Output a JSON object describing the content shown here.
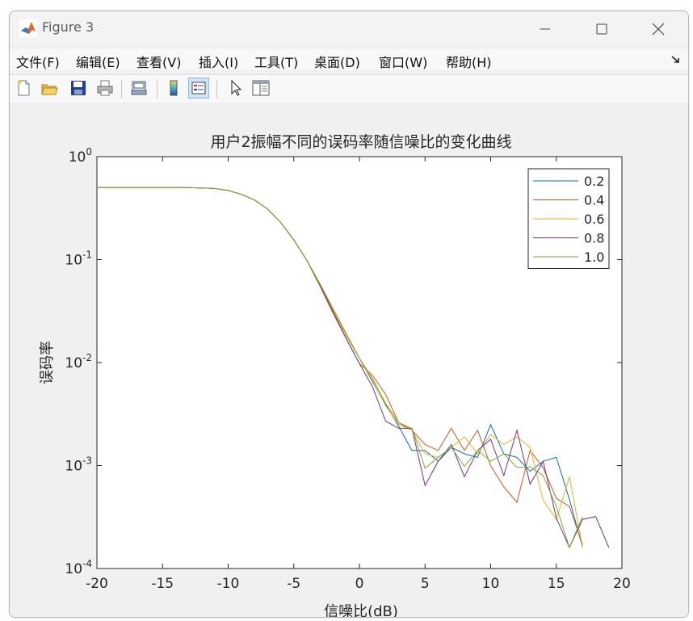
{
  "window": {
    "title": "Figure 3",
    "controls": {
      "minimize": "minimize-icon",
      "maximize": "maximize-icon",
      "close": "close-icon"
    }
  },
  "menu": {
    "items": [
      "文件(F)",
      "编辑(E)",
      "查看(V)",
      "插入(I)",
      "工具(T)",
      "桌面(D)",
      "窗口(W)",
      "帮助(H)"
    ]
  },
  "toolbar": {
    "buttons": [
      "new-figure-icon",
      "open-file-icon",
      "save-icon",
      "print-icon",
      "print-preview-icon",
      "colorbar-icon",
      "legend-icon",
      "pointer-icon",
      "property-inspector-icon"
    ]
  },
  "chart_data": {
    "type": "line",
    "title": "用户2振幅不同的误码率随信噪比的变化曲线",
    "xlabel": "信噪比(dB)",
    "ylabel": "误码率",
    "xlim": [
      -20,
      20
    ],
    "ylim": [
      0.0001,
      1
    ],
    "yscale": "log",
    "xticks": [
      "-20",
      "-15",
      "-10",
      "-5",
      "0",
      "5",
      "10",
      "15",
      "20"
    ],
    "yticks": [
      {
        "base": "10",
        "exp": "0"
      },
      {
        "base": "10",
        "exp": "-1"
      },
      {
        "base": "10",
        "exp": "-2"
      },
      {
        "base": "10",
        "exp": "-3"
      },
      {
        "base": "10",
        "exp": "-4"
      }
    ],
    "grid": false,
    "legend_position": "top-right",
    "series": [
      {
        "name": "0.2",
        "color": "#0072bd",
        "x": [
          -20,
          -19,
          -18,
          -17,
          -16,
          -15,
          -14,
          -13,
          -12,
          -11,
          -10,
          -9,
          -8,
          -7,
          -6,
          -5,
          -4,
          -3,
          -2,
          -1,
          0,
          1,
          2,
          3,
          4,
          5,
          6,
          7,
          8,
          9,
          10,
          11,
          12,
          13,
          14,
          15,
          16,
          17
        ],
        "y": [
          0.5,
          0.5,
          0.5,
          0.5,
          0.5,
          0.5,
          0.5,
          0.5,
          0.497,
          0.49,
          0.47,
          0.43,
          0.38,
          0.31,
          0.23,
          0.155,
          0.098,
          0.058,
          0.033,
          0.019,
          0.011,
          0.0065,
          0.0039,
          0.0024,
          0.0014,
          0.0014,
          0.0011,
          0.0015,
          0.0013,
          0.0012,
          0.0025,
          0.0013,
          0.0012,
          0.00088,
          0.0011,
          0.0012,
          0.00047,
          0.00016
        ]
      },
      {
        "name": "0.4",
        "color": "#d95319",
        "x": [
          -20,
          -19,
          -18,
          -17,
          -16,
          -15,
          -14,
          -13,
          -12,
          -11,
          -10,
          -9,
          -8,
          -7,
          -6,
          -5,
          -4,
          -3,
          -2,
          -1,
          0,
          1,
          2,
          3,
          4,
          5,
          6,
          7,
          8,
          9,
          10,
          11,
          12,
          13,
          14,
          15,
          16,
          17
        ],
        "y": [
          0.5,
          0.5,
          0.5,
          0.5,
          0.5,
          0.5,
          0.5,
          0.5,
          0.497,
          0.49,
          0.47,
          0.43,
          0.38,
          0.31,
          0.23,
          0.155,
          0.098,
          0.055,
          0.03,
          0.017,
          0.0098,
          0.0075,
          0.0049,
          0.0026,
          0.0022,
          0.0016,
          0.0014,
          0.0023,
          0.0014,
          0.0022,
          0.001,
          0.00062,
          0.00044,
          0.0014,
          0.00095,
          0.00048,
          0.0004,
          0.00017
        ]
      },
      {
        "name": "0.6",
        "color": "#edb120",
        "x": [
          -20,
          -19,
          -18,
          -17,
          -16,
          -15,
          -14,
          -13,
          -12,
          -11,
          -10,
          -9,
          -8,
          -7,
          -6,
          -5,
          -4,
          -3,
          -2,
          -1,
          0,
          1,
          2,
          3,
          4,
          5,
          6,
          7,
          8,
          9,
          10,
          11,
          12,
          13,
          14,
          15,
          16,
          17
        ],
        "y": [
          0.5,
          0.5,
          0.5,
          0.5,
          0.5,
          0.5,
          0.5,
          0.5,
          0.497,
          0.49,
          0.47,
          0.43,
          0.38,
          0.31,
          0.23,
          0.155,
          0.098,
          0.058,
          0.032,
          0.018,
          0.011,
          0.0067,
          0.0038,
          0.0025,
          0.0022,
          0.0013,
          0.0012,
          0.0015,
          0.0019,
          0.0013,
          0.002,
          0.0016,
          0.0019,
          0.0015,
          0.00046,
          0.0003,
          0.00078,
          0.00016
        ]
      },
      {
        "name": "0.8",
        "color": "#7e2f8e",
        "x": [
          -20,
          -19,
          -18,
          -17,
          -16,
          -15,
          -14,
          -13,
          -12,
          -11,
          -10,
          -9,
          -8,
          -7,
          -6,
          -5,
          -4,
          -3,
          -2,
          -1,
          0,
          1,
          2,
          3,
          4,
          5,
          6,
          7,
          8,
          9,
          10,
          11,
          12,
          13,
          14,
          15,
          16,
          17,
          18,
          19
        ],
        "y": [
          0.5,
          0.5,
          0.5,
          0.5,
          0.5,
          0.5,
          0.5,
          0.5,
          0.497,
          0.49,
          0.47,
          0.43,
          0.38,
          0.31,
          0.23,
          0.155,
          0.098,
          0.057,
          0.031,
          0.017,
          0.0098,
          0.0058,
          0.0027,
          0.0023,
          0.0023,
          0.00064,
          0.0011,
          0.0016,
          0.00078,
          0.0014,
          0.0018,
          0.0008,
          0.0022,
          0.00066,
          0.0011,
          0.00031,
          0.00016,
          0.0003,
          0.00032,
          0.00016
        ]
      },
      {
        "name": "1.0",
        "color": "#77ac30",
        "x": [
          -20,
          -19,
          -18,
          -17,
          -16,
          -15,
          -14,
          -13,
          -12,
          -11,
          -10,
          -9,
          -8,
          -7,
          -6,
          -5,
          -4,
          -3,
          -2,
          -1,
          0,
          1,
          2,
          3,
          4,
          5,
          6,
          7,
          8,
          9,
          10,
          11,
          12,
          13,
          14,
          15,
          16,
          17
        ],
        "y": [
          0.5,
          0.5,
          0.5,
          0.5,
          0.5,
          0.5,
          0.5,
          0.5,
          0.497,
          0.49,
          0.47,
          0.43,
          0.38,
          0.31,
          0.23,
          0.155,
          0.098,
          0.058,
          0.033,
          0.019,
          0.011,
          0.007,
          0.004,
          0.0026,
          0.0023,
          0.00094,
          0.0012,
          0.0015,
          0.00098,
          0.0014,
          0.0011,
          0.0013,
          0.00096,
          0.00097,
          0.0008,
          0.0004,
          0.00016,
          0.00032
        ]
      }
    ]
  }
}
